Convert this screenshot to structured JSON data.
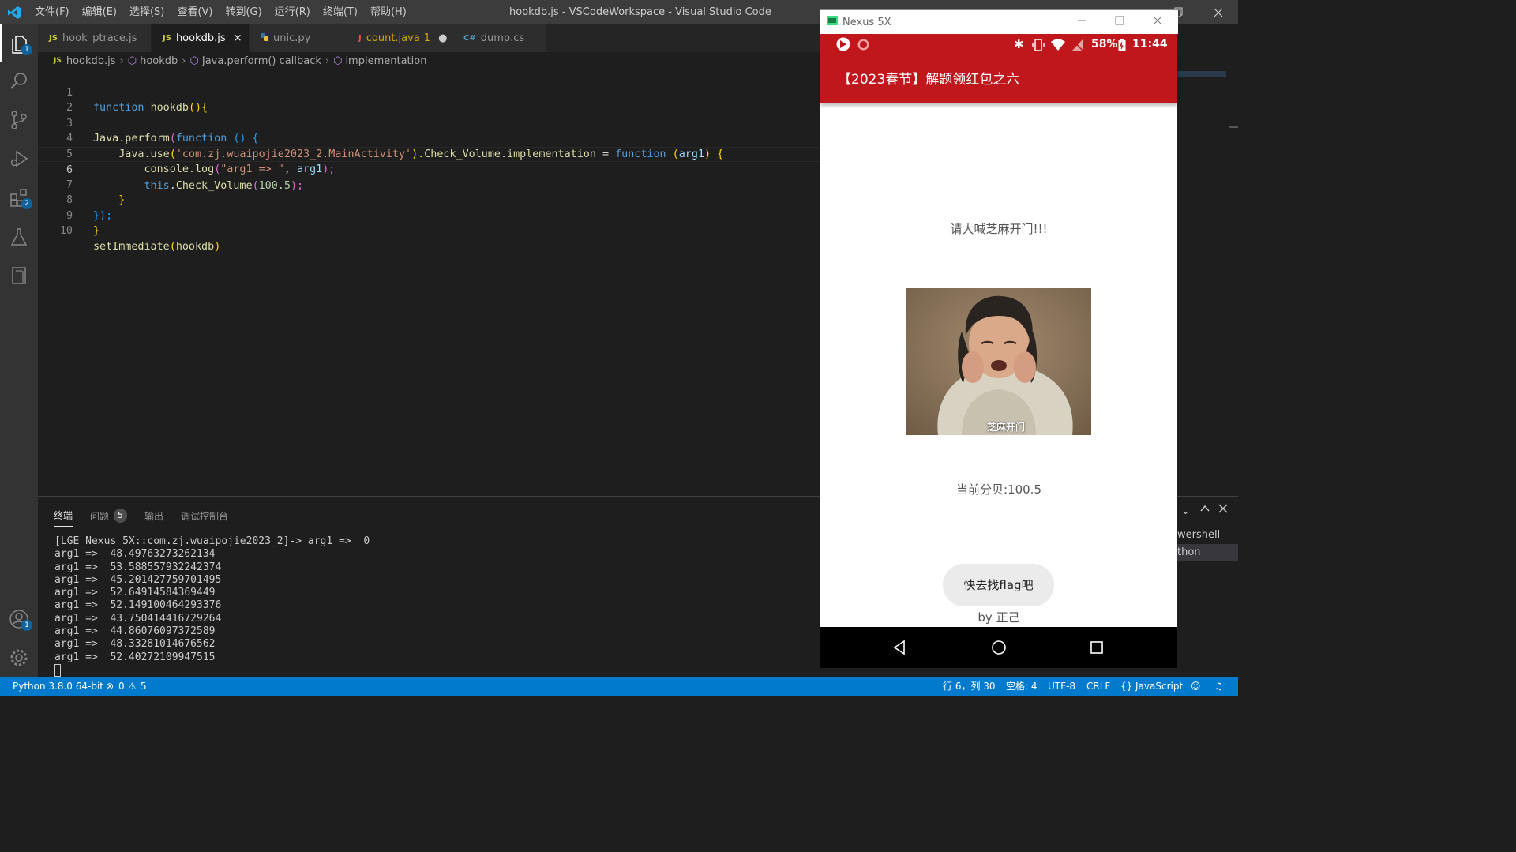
{
  "titlebar": {
    "menu": [
      "文件(F)",
      "编辑(E)",
      "选择(S)",
      "查看(V)",
      "转到(G)",
      "运行(R)",
      "终端(T)",
      "帮助(H)"
    ],
    "title": "hookdb.js - VSCodeWorkspace - Visual Studio Code"
  },
  "activity": {
    "explorer_badge": "1",
    "extensions_badge": "2",
    "accounts_badge": "1"
  },
  "tabs": [
    {
      "icon": "JS",
      "label": "hook_ptrace.js"
    },
    {
      "icon": "JS",
      "label": "hookdb.js",
      "close": "×"
    },
    {
      "icon": "py-icon",
      "label": "unic.py"
    },
    {
      "icon": "J",
      "label": "count.java",
      "problems": "1",
      "modified": "●"
    },
    {
      "icon": "C#",
      "label": "dump.cs"
    }
  ],
  "breadcrumb": [
    "hookdb.js",
    "hookdb",
    "Java.perform() callback",
    "implementation"
  ],
  "editor": {
    "line_numbers": [
      "1",
      "2",
      "3",
      "4",
      "5",
      "6",
      "7",
      "8",
      "9",
      "10"
    ],
    "l1": {
      "kw": "function",
      "fn": "hookdb",
      "p": "(){"
    },
    "l3": {
      "fn": "Java.perform",
      "p1": "(",
      "kw": "function",
      "p2": " () {"
    },
    "l4": {
      "fn": "Java.use",
      "p1": "(",
      "st": "'com.zj.wuaipojie2023_2.MainActivity'",
      "p2": ").",
      "fn2": "Check_Volume",
      "dot": ".",
      "fn3": "implementation",
      "eq": " = ",
      "kw": "function",
      "p3": " (",
      "pm": "arg1",
      "p4": ") {"
    },
    "l5": {
      "fn": "console.log",
      "p1": "(",
      "st": "\"arg1 => \"",
      "c": ", ",
      "pm": "arg1",
      "p2": ");"
    },
    "l6": {
      "kw": "this",
      "dot": ".",
      "fn": "Check_Volume",
      "p1": "(",
      "nm": "100.5",
      "p2": ");"
    },
    "l7": "}",
    "l8": "});",
    "l9": "}",
    "l10": {
      "fn": "setImmediate",
      "p1": "(",
      "pm": "hookdb",
      "p2": ")"
    }
  },
  "panel": {
    "tabs": [
      "终端",
      "问题",
      "输出",
      "调试控制台"
    ],
    "problems_count": "5",
    "terminal_lines": [
      "[LGE Nexus 5X::com.zj.wuaipojie2023_2]-> arg1 =>  0",
      "arg1 =>  48.49763273262134",
      "arg1 =>  53.588557932242374",
      "arg1 =>  45.201427759701495",
      "arg1 =>  52.64914584369449",
      "arg1 =>  52.149100464293376",
      "arg1 =>  43.750414416729264",
      "arg1 =>  44.86076097372589",
      "arg1 =>  48.33281014676562",
      "arg1 =>  52.40272109947515"
    ],
    "shell_list": [
      "wershell",
      "thon"
    ]
  },
  "statusbar": {
    "python": "Python 3.8.0 64-bit",
    "errors": "0",
    "warnings": "5",
    "position": "行 6，列 30",
    "spaces": "空格: 4",
    "encoding": "UTF-8",
    "eol": "CRLF",
    "language": "JavaScript"
  },
  "emulator": {
    "window_title": "Nexus 5X",
    "battery": "58%",
    "time": "11:44",
    "app_title": "【2023春节】解题领红包之六",
    "prompt": "请大喊芝麻开门!!!",
    "image_caption": "芝麻开门",
    "volume": "当前分贝:100.5",
    "button": "快去找flag吧",
    "byline": "by 正己"
  },
  "colors": {
    "accent": "#007acc",
    "app_red": "#c0171c",
    "editor_bg": "#1e1e1e"
  }
}
